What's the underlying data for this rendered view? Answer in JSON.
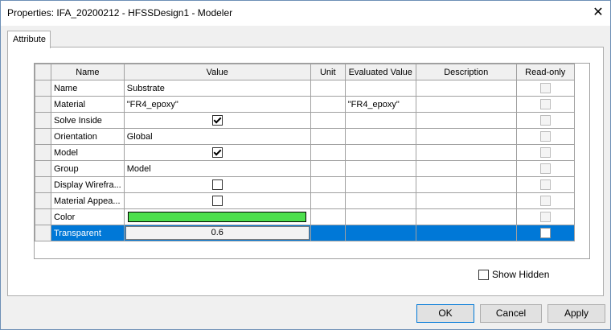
{
  "window": {
    "title": "Properties: IFA_20200212 - HFSSDesign1 - Modeler",
    "close_glyph": "✕"
  },
  "tabs": [
    {
      "label": "Attribute"
    }
  ],
  "grid": {
    "columns": [
      "Name",
      "Value",
      "Unit",
      "Evaluated Value",
      "Description",
      "Read-only"
    ],
    "rows": [
      {
        "name": "Name",
        "value": "Substrate",
        "unit": "",
        "evaluated": "",
        "description": ""
      },
      {
        "name": "Material",
        "value": "\"FR4_epoxy\"",
        "unit": "",
        "evaluated": "\"FR4_epoxy\"",
        "description": ""
      },
      {
        "name": "Solve Inside",
        "value_checkbox": true,
        "unit": "",
        "evaluated": "",
        "description": ""
      },
      {
        "name": "Orientation",
        "value": "Global",
        "unit": "",
        "evaluated": "",
        "description": ""
      },
      {
        "name": "Model",
        "value_checkbox": true,
        "unit": "",
        "evaluated": "",
        "description": ""
      },
      {
        "name": "Group",
        "value": "Model",
        "unit": "",
        "evaluated": "",
        "description": ""
      },
      {
        "name": "Display Wirefra...",
        "value_checkbox": false,
        "unit": "",
        "evaluated": "",
        "description": ""
      },
      {
        "name": "Material Appea...",
        "value_checkbox": false,
        "unit": "",
        "evaluated": "",
        "description": ""
      },
      {
        "name": "Color",
        "color": "#4ddf4d",
        "unit": "",
        "evaluated": "",
        "description": ""
      },
      {
        "name": "Transparent",
        "value": "0.6",
        "unit": "",
        "evaluated": "",
        "description": "",
        "selected": true
      }
    ]
  },
  "show_hidden": {
    "label": "Show Hidden",
    "checked": false
  },
  "buttons": {
    "ok": "OK",
    "cancel": "Cancel",
    "apply": "Apply"
  },
  "colors": {
    "selection": "#0078d7",
    "color_swatch": "#4ddf4d"
  }
}
